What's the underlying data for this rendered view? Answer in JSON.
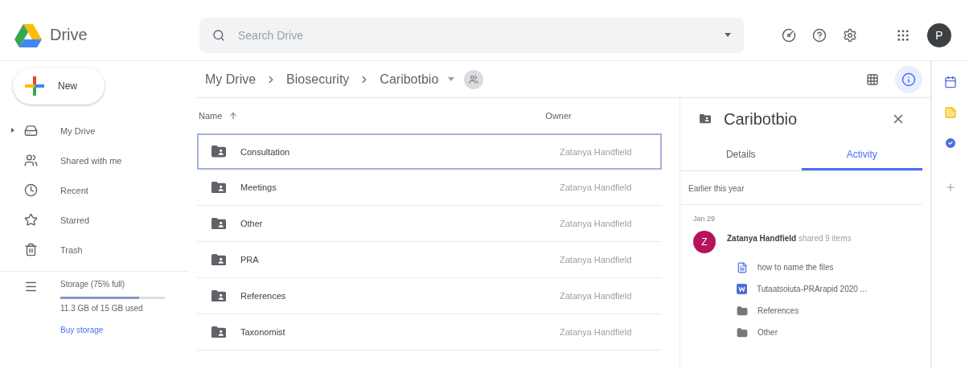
{
  "header": {
    "app_name": "Drive",
    "search": {
      "placeholder": "Search Drive"
    },
    "avatar": "P"
  },
  "new_button": "New",
  "sidebar": {
    "items": [
      {
        "label": "My Drive",
        "kind": "drive",
        "selected": false
      },
      {
        "label": "Shared with me",
        "kind": "shared",
        "selected": false
      },
      {
        "label": "Recent",
        "kind": "recent",
        "selected": false
      },
      {
        "label": "Starred",
        "kind": "starred",
        "selected": false
      },
      {
        "label": "Trash",
        "kind": "trash",
        "selected": false
      }
    ],
    "storage": {
      "label": "Storage (75% full)",
      "level": 0.75,
      "usage": "11.3 GB of 15 GB used",
      "link": "Buy storage"
    }
  },
  "breadcrumb": [
    "My Drive",
    "Biosecurity",
    "Caribotbio"
  ],
  "table": {
    "columns": [
      "Name",
      "Owner"
    ],
    "rows": [
      {
        "name": "Consultation",
        "owner": "Zatanya Handfield",
        "selected": true
      },
      {
        "name": "Meetings",
        "owner": "Zatanya Handfield",
        "selected": false
      },
      {
        "name": "Other",
        "owner": "Zatanya Handfield",
        "selected": false
      },
      {
        "name": "PRA",
        "owner": "Zatanya Handfield",
        "selected": false
      },
      {
        "name": "References",
        "owner": "Zatanya Handfield",
        "selected": false
      },
      {
        "name": "Taxonomist",
        "owner": "Zatanya Handfield",
        "selected": false
      }
    ]
  },
  "details": {
    "title": "Caribotbio",
    "tabs": [
      {
        "label": "Details",
        "selected": false
      },
      {
        "label": "Activity",
        "selected": true
      }
    ],
    "section": "Earlier this year",
    "date": "Jan 29",
    "activity": {
      "avatar": "Z",
      "actor": "Zatanya Handfield",
      "action": "shared 9 items",
      "items": [
        {
          "kind": "doc",
          "name": "how to name the files"
        },
        {
          "kind": "word",
          "name": "Tutaatsoiuta-PRArapid 2020 ..."
        },
        {
          "kind": "folder",
          "name": "References"
        },
        {
          "kind": "folder",
          "name": "Other"
        }
      ]
    }
  }
}
